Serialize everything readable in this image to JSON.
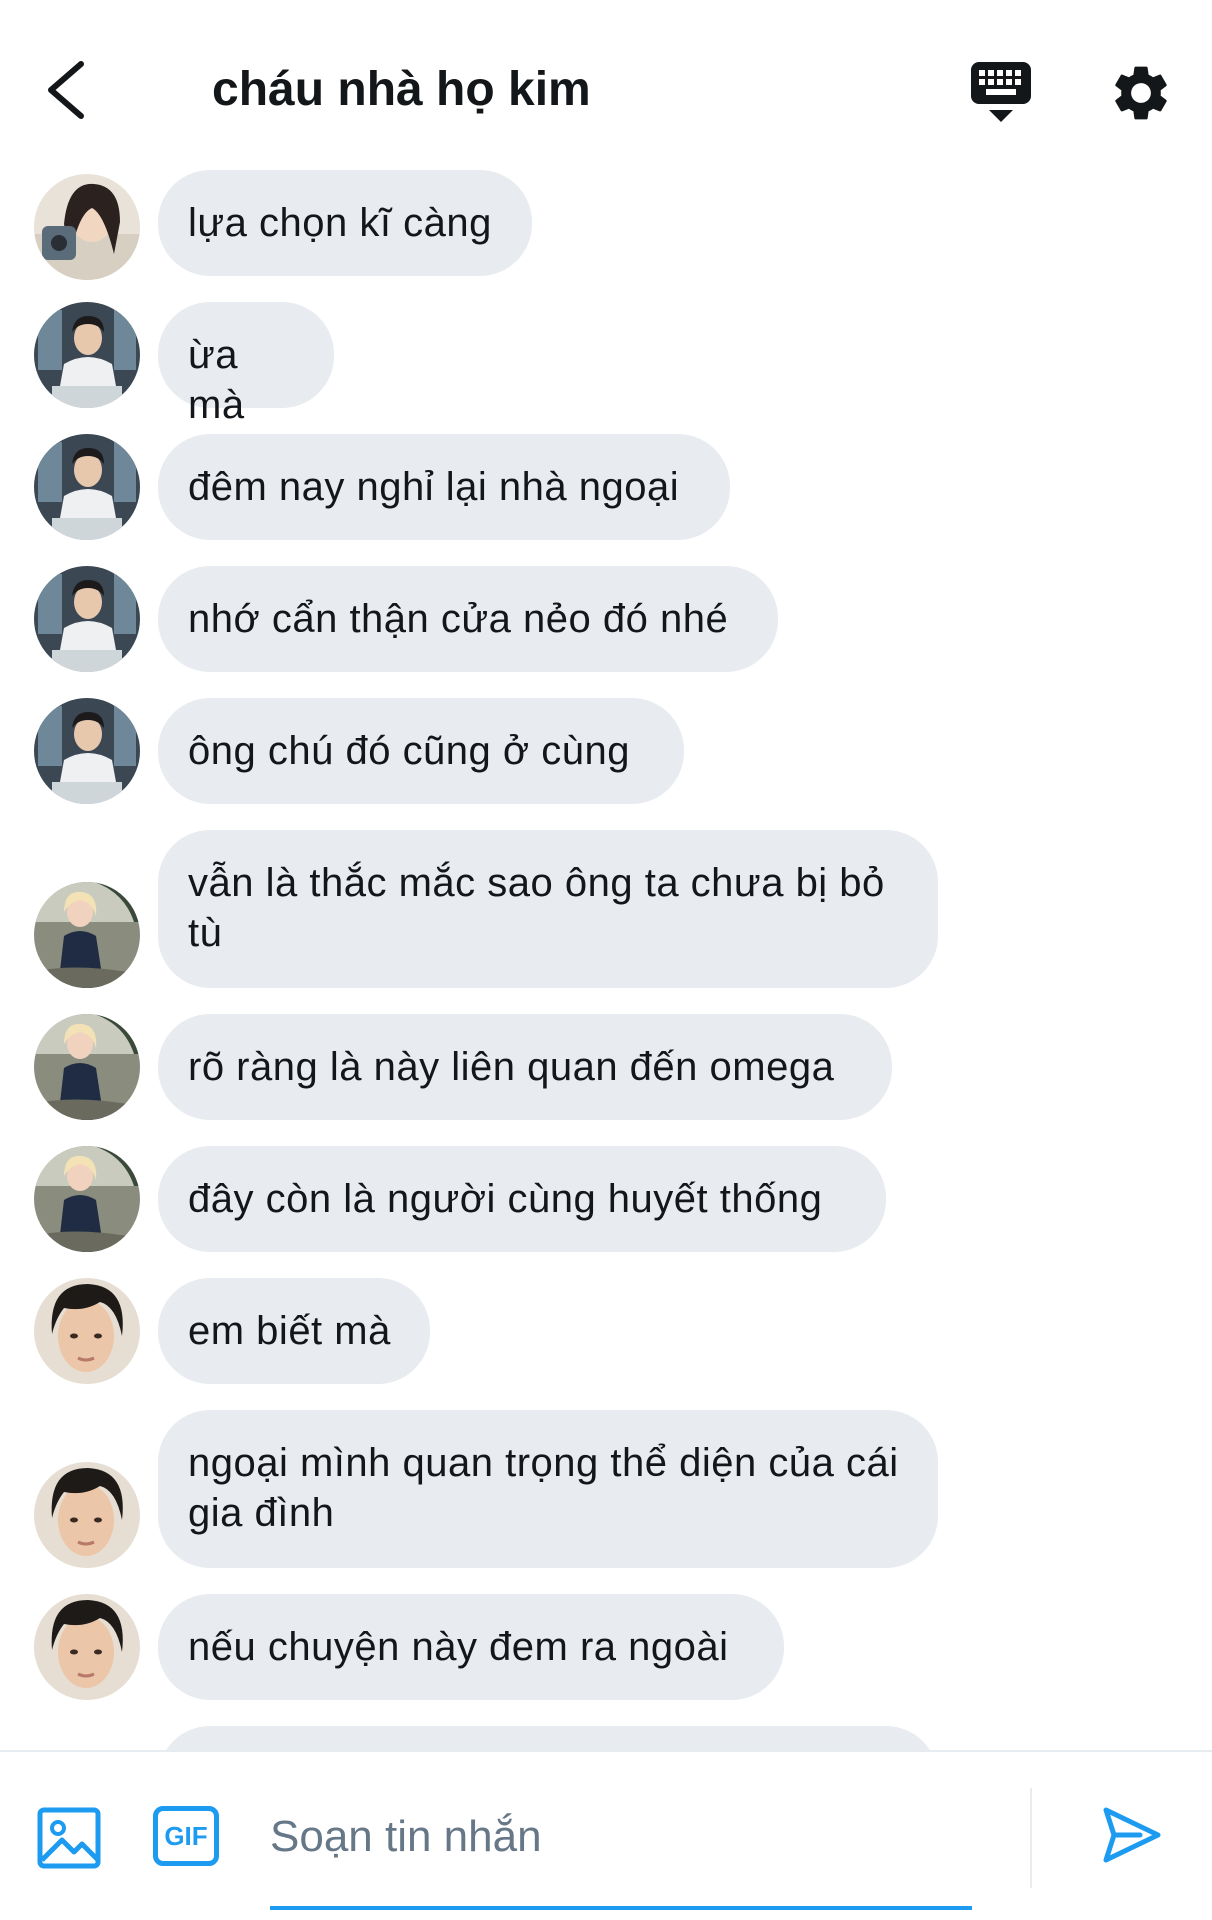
{
  "header": {
    "title": "cháu nhà họ kim",
    "icons": {
      "back": "chevron-left-icon",
      "keyboard": "keyboard-icon",
      "settings": "gear-icon"
    }
  },
  "messages": [
    {
      "text": "lựa chọn kĩ càng",
      "sender": "girl-selfie"
    },
    {
      "text": "ừa mà",
      "sender": "boy-shirt"
    },
    {
      "text": "đêm nay nghỉ lại nhà ngoại",
      "sender": "boy-shirt"
    },
    {
      "text": "nhớ cẩn thận cửa nẻo đó nhé",
      "sender": "boy-shirt"
    },
    {
      "text": "ông chú đó cũng ở cùng",
      "sender": "boy-shirt"
    },
    {
      "text": "vẫn là thắc mắc sao ông ta chưa bị bỏ tù",
      "sender": "blonde"
    },
    {
      "text": "rõ ràng là này liên quan đến omega",
      "sender": "blonde"
    },
    {
      "text": "đây còn là người cùng huyết thống",
      "sender": "blonde"
    },
    {
      "text": "em biết mà",
      "sender": "dark-hair"
    },
    {
      "text": "ngoại mình quan trọng thể diện của cái gia đình",
      "sender": "dark-hair"
    },
    {
      "text": "nếu chuyện này đem ra ngoài",
      "sender": "dark-hair"
    }
  ],
  "composer": {
    "placeholder": "Soạn tin nhắn",
    "gif_label": "GIF",
    "icons": {
      "image": "image-icon",
      "send": "send-icon"
    }
  },
  "colors": {
    "accent": "#1d9bf0",
    "bubble": "#e8ebef",
    "text": "#14171a",
    "placeholder": "#667787"
  }
}
